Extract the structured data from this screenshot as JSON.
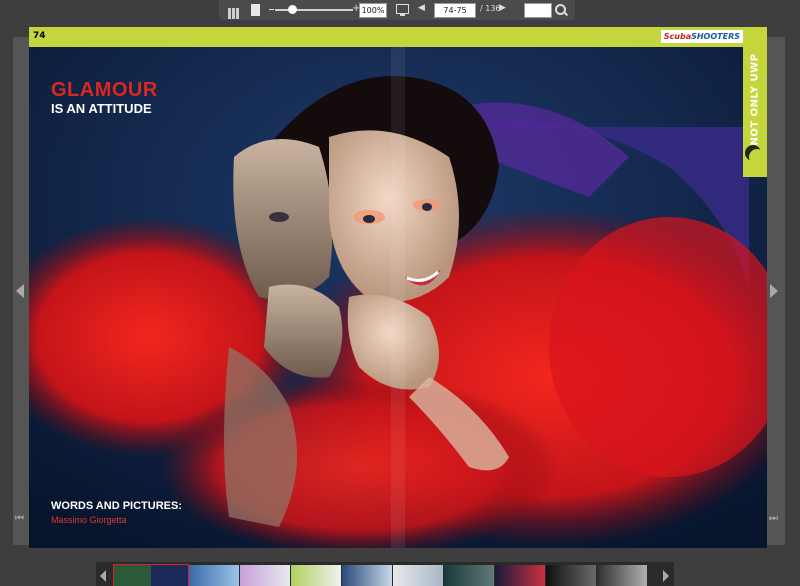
{
  "toolbar": {
    "zoom_value": "100%",
    "page_range": "74-75",
    "page_total": "/ 136",
    "search_placeholder": "",
    "icons": [
      "thumbnails-icon",
      "single-page-icon",
      "zoom-slider",
      "fullscreen-icon",
      "prev-page-icon",
      "next-page-icon",
      "search-icon"
    ]
  },
  "page": {
    "number": "74",
    "logo_part1": "Scuba",
    "logo_part2": "SHOOTERS",
    "side_tab": "NOT ONLY UWP",
    "headline": "GLAMOUR",
    "subhead": "IS AN ATTITUDE",
    "credit_label": "WORDS AND PICTURES:",
    "credit_name": "Massimo Giorgetta"
  },
  "colors": {
    "accent_green": "#c4d63c",
    "headline_red": "#d8281f",
    "background": "#3e3e3e"
  }
}
